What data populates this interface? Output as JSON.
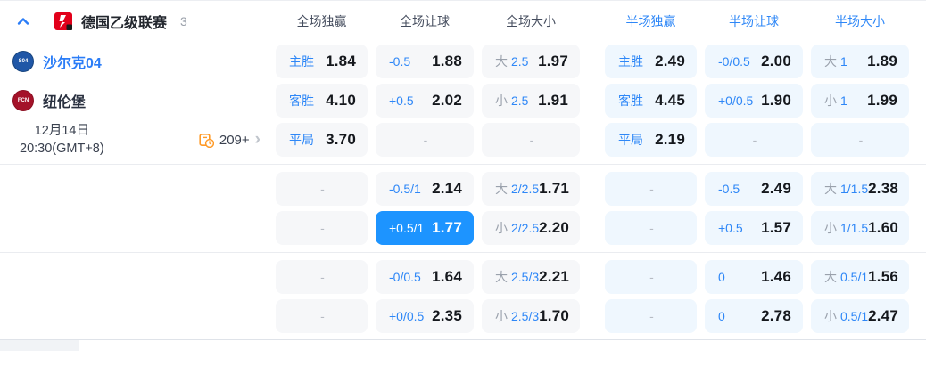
{
  "league_header": {
    "name": "德国乙级联赛",
    "match_count": "3",
    "columns": [
      {
        "label": "全场独赢",
        "group": "full"
      },
      {
        "label": "全场让球",
        "group": "full"
      },
      {
        "label": "全场大小",
        "group": "full"
      },
      {
        "label": "半场独赢",
        "group": "half"
      },
      {
        "label": "半场让球",
        "group": "half"
      },
      {
        "label": "半场大小",
        "group": "half"
      }
    ]
  },
  "match_info": {
    "home_team": "沙尔克04",
    "home_logo_text": "S04",
    "away_team": "纽伦堡",
    "away_logo_text": "FCN",
    "date": "12月14日",
    "time": "20:30(GMT+8)",
    "more_markets": "209+"
  },
  "odds_rows": [
    [
      {
        "t": "win",
        "label": "主胜",
        "value": "1.84"
      },
      {
        "t": "hcp",
        "label": "-0.5",
        "value": "1.88"
      },
      {
        "t": "ou",
        "side": "大",
        "line": "2.5",
        "value": "1.97"
      },
      {
        "t": "win",
        "label": "主胜",
        "value": "2.49"
      },
      {
        "t": "hcp",
        "label": "-0/0.5",
        "value": "2.00"
      },
      {
        "t": "ou",
        "side": "大",
        "line": "1",
        "value": "1.89"
      }
    ],
    [
      {
        "t": "win",
        "label": "客胜",
        "value": "4.10"
      },
      {
        "t": "hcp",
        "label": "+0.5",
        "value": "2.02"
      },
      {
        "t": "ou",
        "side": "小",
        "line": "2.5",
        "value": "1.91"
      },
      {
        "t": "win",
        "label": "客胜",
        "value": "4.45"
      },
      {
        "t": "hcp",
        "label": "+0/0.5",
        "value": "1.90"
      },
      {
        "t": "ou",
        "side": "小",
        "line": "1",
        "value": "1.99"
      }
    ],
    [
      {
        "t": "win",
        "label": "平局",
        "value": "3.70"
      },
      {
        "t": "dash"
      },
      {
        "t": "dash"
      },
      {
        "t": "win",
        "label": "平局",
        "value": "2.19"
      },
      {
        "t": "dash"
      },
      {
        "t": "dash"
      }
    ],
    [
      {
        "t": "dash"
      },
      {
        "t": "hcp",
        "label": "-0.5/1",
        "value": "2.14"
      },
      {
        "t": "ou",
        "side": "大",
        "line": "2/2.5",
        "value": "1.71"
      },
      {
        "t": "dash"
      },
      {
        "t": "hcp",
        "label": "-0.5",
        "value": "2.49"
      },
      {
        "t": "ou",
        "side": "大",
        "line": "1/1.5",
        "value": "2.38"
      }
    ],
    [
      {
        "t": "dash"
      },
      {
        "t": "hcp",
        "label": "+0.5/1",
        "value": "1.77",
        "selected": true
      },
      {
        "t": "ou",
        "side": "小",
        "line": "2/2.5",
        "value": "2.20"
      },
      {
        "t": "dash"
      },
      {
        "t": "hcp",
        "label": "+0.5",
        "value": "1.57"
      },
      {
        "t": "ou",
        "side": "小",
        "line": "1/1.5",
        "value": "1.60"
      }
    ],
    [
      {
        "t": "dash"
      },
      {
        "t": "hcp",
        "label": "-0/0.5",
        "value": "1.64"
      },
      {
        "t": "ou",
        "side": "大",
        "line": "2.5/3",
        "value": "2.21"
      },
      {
        "t": "dash"
      },
      {
        "t": "hcp",
        "label": "0",
        "value": "1.46"
      },
      {
        "t": "ou",
        "side": "大",
        "line": "0.5/1",
        "value": "1.56"
      }
    ],
    [
      {
        "t": "dash"
      },
      {
        "t": "hcp",
        "label": "+0/0.5",
        "value": "2.35"
      },
      {
        "t": "ou",
        "side": "小",
        "line": "2.5/3",
        "value": "1.70"
      },
      {
        "t": "dash"
      },
      {
        "t": "hcp",
        "label": "0",
        "value": "2.78"
      },
      {
        "t": "ou",
        "side": "小",
        "line": "0.5/1",
        "value": "2.47"
      }
    ]
  ],
  "icons": {
    "chevron_up": "collapse-league",
    "chevron_right": "›",
    "markets_clock": "orange-document-clock"
  },
  "colors": {
    "accent_blue": "#2e87f7",
    "selected_cell_bg": "#1d94ff",
    "full_cell_bg": "#f6f7f9",
    "half_cell_bg": "#eff7fe",
    "value_text": "#15181d",
    "muted_gray": "#9aa1ac",
    "league_logo_red": "#e2001a",
    "markets_icon_orange": "#ff9a27",
    "home_logo_blue": "#2057a7",
    "away_logo_red": "#a41229"
  }
}
